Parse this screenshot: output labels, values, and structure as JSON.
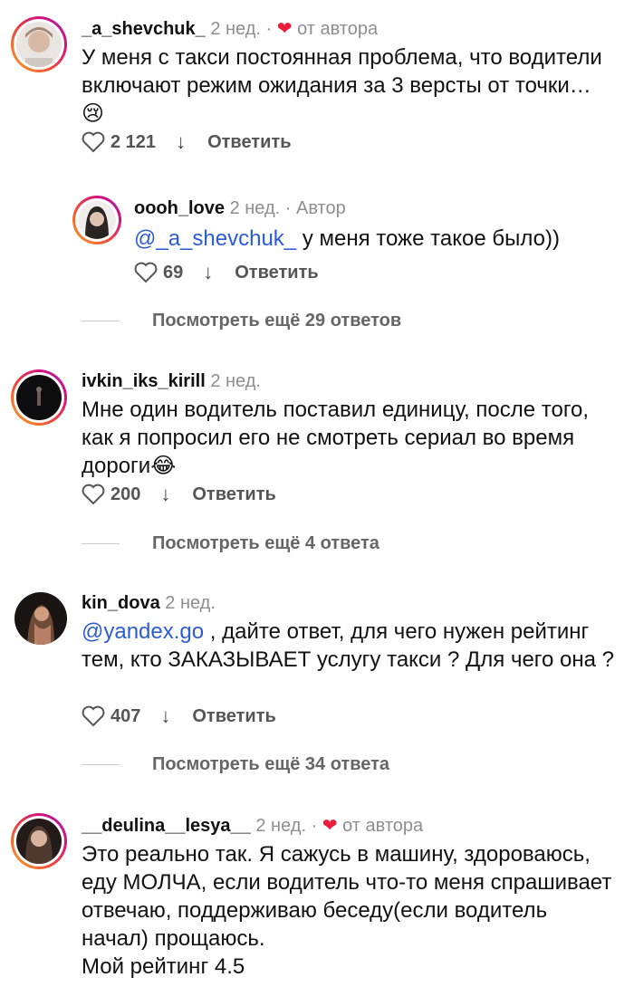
{
  "comments": [
    {
      "username": "_a_shevchuk_",
      "time": "2 нед. ·",
      "liked_by_author": "от автора",
      "text": "У меня с такси постоянная проблема, что водители включают режим ожидания за 3 версты от точки…",
      "emoji": "😢",
      "likes": "2 121",
      "reply_label": "Ответить",
      "reply": {
        "username": "oooh_love",
        "time": "2 нед. · Автор",
        "mention": "@_a_shevchuk_",
        "text": " у меня тоже такое было))",
        "likes": "69",
        "reply_label": "Ответить"
      },
      "more_replies": "Посмотреть ещё 29 ответов"
    },
    {
      "username": "ivkin_iks_kirill",
      "time": "2 нед.",
      "text": "Мне один водитель поставил единицу, после того, как я попросил его не смотреть сериал во время дороги",
      "emoji": "😂",
      "likes": "200",
      "reply_label": "Ответить",
      "more_replies": "Посмотреть ещё 4 ответа"
    },
    {
      "username": "kin_dova",
      "time": "2 нед.",
      "mention": "@yandex.go",
      "text": " , дайте ответ, для чего нужен рейтинг тем, кто ЗАКАЗЫВАЕТ услугу такси ? Для чего она ?",
      "likes": "407",
      "reply_label": "Ответить",
      "more_replies": "Посмотреть ещё 34 ответа"
    },
    {
      "username": "__deulina__lesya__",
      "time": "2 нед. ·",
      "liked_by_author": "от автора",
      "text": "Это реально так. Я сажусь в машину, здороваюсь, еду МОЛЧА, если водитель что-то меня спрашивает отвечаю, поддерживаю беседу(если водитель начал) прощаюсь.",
      "text_extra": "Мой рейтинг 4.5"
    }
  ],
  "icons": {
    "heart": "heart-icon",
    "down": "arrow-down-icon",
    "like": "heart-outline-icon"
  },
  "colors": {
    "mention": "#2b5bd6",
    "liked_heart": "#ed1c3b",
    "muted": "#8e8e8e"
  }
}
